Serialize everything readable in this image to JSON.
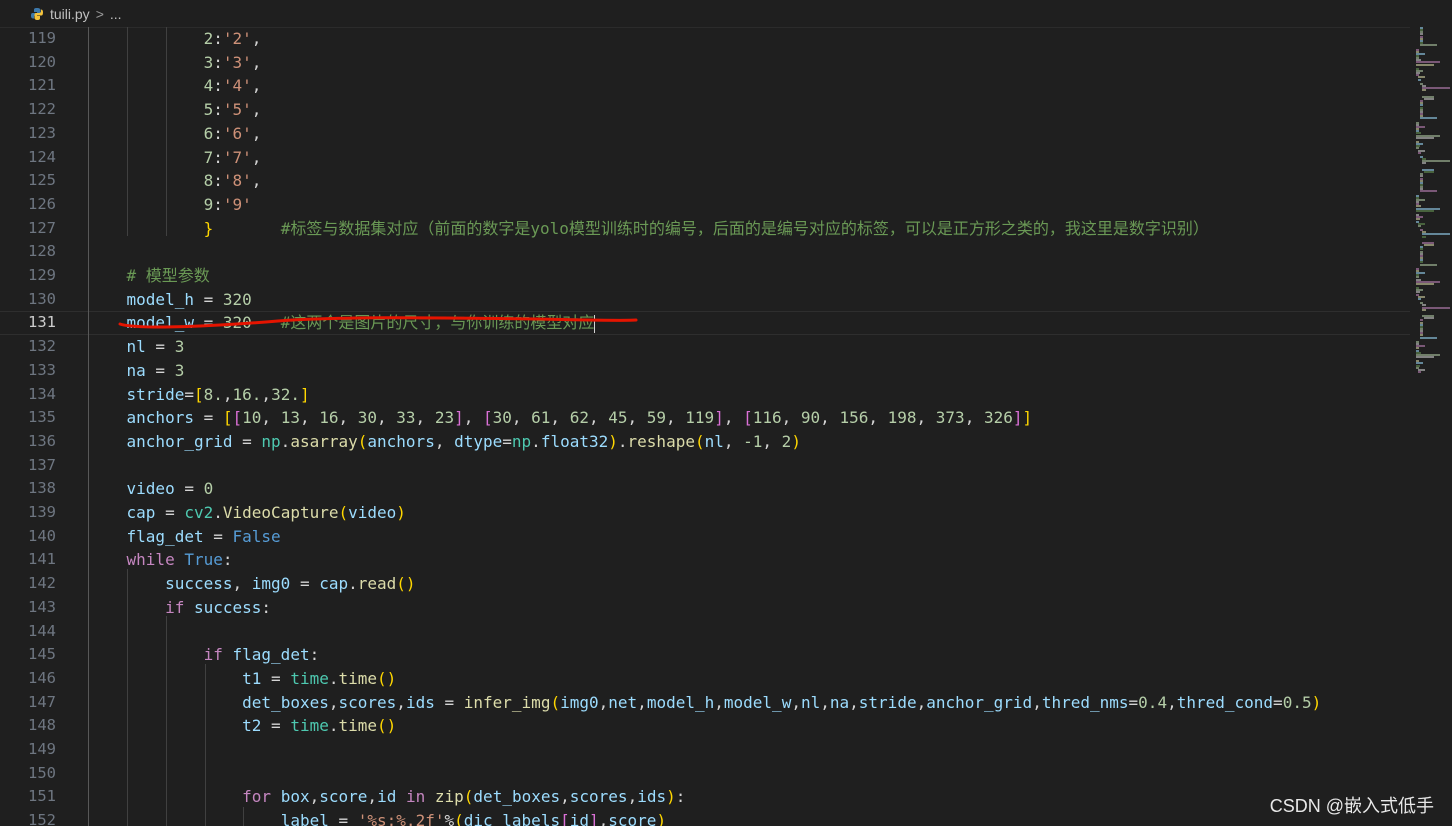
{
  "breadcrumb": {
    "file": "tuili.py",
    "separator": ">",
    "more": "..."
  },
  "watermark": "CSDN @嵌入式低手",
  "active_line": 131,
  "colors": {
    "plain": "#d4d4d4",
    "variable": "#9cdcfe",
    "number": "#b5cea8",
    "string": "#ce9178",
    "comment": "#6a9955",
    "keyword": "#c586c0",
    "constant": "#569cd6",
    "function": "#dcdcaa",
    "module": "#4ec9b0",
    "bracket_gold": "#ffd700",
    "bracket_pink": "#da70d6",
    "bracket_blue": "#179fff",
    "annotation": "#e51400"
  },
  "lines": [
    {
      "n": "119",
      "indent": 3,
      "tokens": [
        [
          "number",
          "2"
        ],
        [
          "plain",
          ":"
        ],
        [
          "string",
          "'2'"
        ],
        [
          "plain",
          ","
        ]
      ]
    },
    {
      "n": "120",
      "indent": 3,
      "tokens": [
        [
          "number",
          "3"
        ],
        [
          "plain",
          ":"
        ],
        [
          "string",
          "'3'"
        ],
        [
          "plain",
          ","
        ]
      ]
    },
    {
      "n": "121",
      "indent": 3,
      "tokens": [
        [
          "number",
          "4"
        ],
        [
          "plain",
          ":"
        ],
        [
          "string",
          "'4'"
        ],
        [
          "plain",
          ","
        ]
      ]
    },
    {
      "n": "122",
      "indent": 3,
      "tokens": [
        [
          "number",
          "5"
        ],
        [
          "plain",
          ":"
        ],
        [
          "string",
          "'5'"
        ],
        [
          "plain",
          ","
        ]
      ]
    },
    {
      "n": "123",
      "indent": 3,
      "tokens": [
        [
          "number",
          "6"
        ],
        [
          "plain",
          ":"
        ],
        [
          "string",
          "'6'"
        ],
        [
          "plain",
          ","
        ]
      ]
    },
    {
      "n": "124",
      "indent": 3,
      "tokens": [
        [
          "number",
          "7"
        ],
        [
          "plain",
          ":"
        ],
        [
          "string",
          "'7'"
        ],
        [
          "plain",
          ","
        ]
      ]
    },
    {
      "n": "125",
      "indent": 3,
      "tokens": [
        [
          "number",
          "8"
        ],
        [
          "plain",
          ":"
        ],
        [
          "string",
          "'8'"
        ],
        [
          "plain",
          ","
        ]
      ]
    },
    {
      "n": "126",
      "indent": 3,
      "tokens": [
        [
          "number",
          "9"
        ],
        [
          "plain",
          ":"
        ],
        [
          "string",
          "'9'"
        ]
      ]
    },
    {
      "n": "127",
      "indent": 3,
      "tokens": [
        [
          "bracket_gold",
          "}"
        ],
        [
          "plain",
          "       "
        ],
        [
          "comment",
          "#标签与数据集对应（前面的数字是yolo模型训练时的编号，后面的是编号对应的标签，可以是正方形之类的，我这里是数字识别）"
        ]
      ]
    },
    {
      "n": "128",
      "indent": 0,
      "tokens": []
    },
    {
      "n": "129",
      "indent": 1,
      "tokens": [
        [
          "comment",
          "# 模型参数"
        ]
      ]
    },
    {
      "n": "130",
      "indent": 1,
      "tokens": [
        [
          "variable",
          "model_h"
        ],
        [
          "plain",
          " = "
        ],
        [
          "number",
          "320"
        ]
      ]
    },
    {
      "n": "131",
      "indent": 1,
      "tokens": [
        [
          "variable",
          "model_w"
        ],
        [
          "plain",
          " = "
        ],
        [
          "number",
          "320"
        ],
        [
          "plain",
          "   "
        ],
        [
          "comment",
          "#这两个是图片的尺寸，与你训练的模型对应"
        ]
      ]
    },
    {
      "n": "132",
      "indent": 1,
      "tokens": [
        [
          "variable",
          "nl"
        ],
        [
          "plain",
          " = "
        ],
        [
          "number",
          "3"
        ]
      ]
    },
    {
      "n": "133",
      "indent": 1,
      "tokens": [
        [
          "variable",
          "na"
        ],
        [
          "plain",
          " = "
        ],
        [
          "number",
          "3"
        ]
      ]
    },
    {
      "n": "134",
      "indent": 1,
      "tokens": [
        [
          "variable",
          "stride"
        ],
        [
          "plain",
          "="
        ],
        [
          "bracket_gold",
          "["
        ],
        [
          "number",
          "8."
        ],
        [
          "plain",
          ","
        ],
        [
          "number",
          "16."
        ],
        [
          "plain",
          ","
        ],
        [
          "number",
          "32."
        ],
        [
          "bracket_gold",
          "]"
        ]
      ]
    },
    {
      "n": "135",
      "indent": 1,
      "tokens": [
        [
          "variable",
          "anchors"
        ],
        [
          "plain",
          " = "
        ],
        [
          "bracket_gold",
          "["
        ],
        [
          "bracket_pink",
          "["
        ],
        [
          "number",
          "10"
        ],
        [
          "plain",
          ", "
        ],
        [
          "number",
          "13"
        ],
        [
          "plain",
          ", "
        ],
        [
          "number",
          "16"
        ],
        [
          "plain",
          ", "
        ],
        [
          "number",
          "30"
        ],
        [
          "plain",
          ", "
        ],
        [
          "number",
          "33"
        ],
        [
          "plain",
          ", "
        ],
        [
          "number",
          "23"
        ],
        [
          "bracket_pink",
          "]"
        ],
        [
          "plain",
          ", "
        ],
        [
          "bracket_pink",
          "["
        ],
        [
          "number",
          "30"
        ],
        [
          "plain",
          ", "
        ],
        [
          "number",
          "61"
        ],
        [
          "plain",
          ", "
        ],
        [
          "number",
          "62"
        ],
        [
          "plain",
          ", "
        ],
        [
          "number",
          "45"
        ],
        [
          "plain",
          ", "
        ],
        [
          "number",
          "59"
        ],
        [
          "plain",
          ", "
        ],
        [
          "number",
          "119"
        ],
        [
          "bracket_pink",
          "]"
        ],
        [
          "plain",
          ", "
        ],
        [
          "bracket_pink",
          "["
        ],
        [
          "number",
          "116"
        ],
        [
          "plain",
          ", "
        ],
        [
          "number",
          "90"
        ],
        [
          "plain",
          ", "
        ],
        [
          "number",
          "156"
        ],
        [
          "plain",
          ", "
        ],
        [
          "number",
          "198"
        ],
        [
          "plain",
          ", "
        ],
        [
          "number",
          "373"
        ],
        [
          "plain",
          ", "
        ],
        [
          "number",
          "326"
        ],
        [
          "bracket_pink",
          "]"
        ],
        [
          "bracket_gold",
          "]"
        ]
      ]
    },
    {
      "n": "136",
      "indent": 1,
      "tokens": [
        [
          "variable",
          "anchor_grid"
        ],
        [
          "plain",
          " = "
        ],
        [
          "module",
          "np"
        ],
        [
          "plain",
          "."
        ],
        [
          "function",
          "asarray"
        ],
        [
          "bracket_gold",
          "("
        ],
        [
          "variable",
          "anchors"
        ],
        [
          "plain",
          ", "
        ],
        [
          "variable",
          "dtype"
        ],
        [
          "plain",
          "="
        ],
        [
          "module",
          "np"
        ],
        [
          "plain",
          "."
        ],
        [
          "variable",
          "float32"
        ],
        [
          "bracket_gold",
          ")"
        ],
        [
          "plain",
          "."
        ],
        [
          "function",
          "reshape"
        ],
        [
          "bracket_gold",
          "("
        ],
        [
          "variable",
          "nl"
        ],
        [
          "plain",
          ", "
        ],
        [
          "number",
          "-1"
        ],
        [
          "plain",
          ", "
        ],
        [
          "number",
          "2"
        ],
        [
          "bracket_gold",
          ")"
        ]
      ]
    },
    {
      "n": "137",
      "indent": 0,
      "tokens": []
    },
    {
      "n": "138",
      "indent": 1,
      "tokens": [
        [
          "variable",
          "video"
        ],
        [
          "plain",
          " = "
        ],
        [
          "number",
          "0"
        ]
      ]
    },
    {
      "n": "139",
      "indent": 1,
      "tokens": [
        [
          "variable",
          "cap"
        ],
        [
          "plain",
          " = "
        ],
        [
          "module",
          "cv2"
        ],
        [
          "plain",
          "."
        ],
        [
          "function",
          "VideoCapture"
        ],
        [
          "bracket_gold",
          "("
        ],
        [
          "variable",
          "video"
        ],
        [
          "bracket_gold",
          ")"
        ]
      ]
    },
    {
      "n": "140",
      "indent": 1,
      "tokens": [
        [
          "variable",
          "flag_det"
        ],
        [
          "plain",
          " = "
        ],
        [
          "constant",
          "False"
        ]
      ]
    },
    {
      "n": "141",
      "indent": 1,
      "tokens": [
        [
          "keyword",
          "while"
        ],
        [
          "plain",
          " "
        ],
        [
          "constant",
          "True"
        ],
        [
          "plain",
          ":"
        ]
      ]
    },
    {
      "n": "142",
      "indent": 2,
      "tokens": [
        [
          "variable",
          "success"
        ],
        [
          "plain",
          ", "
        ],
        [
          "variable",
          "img0"
        ],
        [
          "plain",
          " = "
        ],
        [
          "variable",
          "cap"
        ],
        [
          "plain",
          "."
        ],
        [
          "function",
          "read"
        ],
        [
          "bracket_gold",
          "()"
        ]
      ]
    },
    {
      "n": "143",
      "indent": 2,
      "tokens": [
        [
          "keyword",
          "if"
        ],
        [
          "plain",
          " "
        ],
        [
          "variable",
          "success"
        ],
        [
          "plain",
          ":"
        ]
      ]
    },
    {
      "n": "144",
      "indent": 0,
      "tokens": []
    },
    {
      "n": "145",
      "indent": 3,
      "tokens": [
        [
          "keyword",
          "if"
        ],
        [
          "plain",
          " "
        ],
        [
          "variable",
          "flag_det"
        ],
        [
          "plain",
          ":"
        ]
      ]
    },
    {
      "n": "146",
      "indent": 4,
      "tokens": [
        [
          "variable",
          "t1"
        ],
        [
          "plain",
          " = "
        ],
        [
          "module",
          "time"
        ],
        [
          "plain",
          "."
        ],
        [
          "function",
          "time"
        ],
        [
          "bracket_gold",
          "()"
        ]
      ]
    },
    {
      "n": "147",
      "indent": 4,
      "tokens": [
        [
          "variable",
          "det_boxes"
        ],
        [
          "plain",
          ","
        ],
        [
          "variable",
          "scores"
        ],
        [
          "plain",
          ","
        ],
        [
          "variable",
          "ids"
        ],
        [
          "plain",
          " = "
        ],
        [
          "function",
          "infer_img"
        ],
        [
          "bracket_gold",
          "("
        ],
        [
          "variable",
          "img0"
        ],
        [
          "plain",
          ","
        ],
        [
          "variable",
          "net"
        ],
        [
          "plain",
          ","
        ],
        [
          "variable",
          "model_h"
        ],
        [
          "plain",
          ","
        ],
        [
          "variable",
          "model_w"
        ],
        [
          "plain",
          ","
        ],
        [
          "variable",
          "nl"
        ],
        [
          "plain",
          ","
        ],
        [
          "variable",
          "na"
        ],
        [
          "plain",
          ","
        ],
        [
          "variable",
          "stride"
        ],
        [
          "plain",
          ","
        ],
        [
          "variable",
          "anchor_grid"
        ],
        [
          "plain",
          ","
        ],
        [
          "variable",
          "thred_nms"
        ],
        [
          "plain",
          "="
        ],
        [
          "number",
          "0.4"
        ],
        [
          "plain",
          ","
        ],
        [
          "variable",
          "thred_cond"
        ],
        [
          "plain",
          "="
        ],
        [
          "number",
          "0.5"
        ],
        [
          "bracket_gold",
          ")"
        ]
      ]
    },
    {
      "n": "148",
      "indent": 4,
      "tokens": [
        [
          "variable",
          "t2"
        ],
        [
          "plain",
          " = "
        ],
        [
          "module",
          "time"
        ],
        [
          "plain",
          "."
        ],
        [
          "function",
          "time"
        ],
        [
          "bracket_gold",
          "()"
        ]
      ]
    },
    {
      "n": "149",
      "indent": 0,
      "tokens": []
    },
    {
      "n": "150",
      "indent": 0,
      "tokens": []
    },
    {
      "n": "151",
      "indent": 4,
      "tokens": [
        [
          "keyword",
          "for"
        ],
        [
          "plain",
          " "
        ],
        [
          "variable",
          "box"
        ],
        [
          "plain",
          ","
        ],
        [
          "variable",
          "score"
        ],
        [
          "plain",
          ","
        ],
        [
          "variable",
          "id"
        ],
        [
          "plain",
          " "
        ],
        [
          "keyword",
          "in"
        ],
        [
          "plain",
          " "
        ],
        [
          "function",
          "zip"
        ],
        [
          "bracket_gold",
          "("
        ],
        [
          "variable",
          "det_boxes"
        ],
        [
          "plain",
          ","
        ],
        [
          "variable",
          "scores"
        ],
        [
          "plain",
          ","
        ],
        [
          "variable",
          "ids"
        ],
        [
          "bracket_gold",
          ")"
        ],
        [
          "plain",
          ":"
        ]
      ]
    },
    {
      "n": "152",
      "indent": 5,
      "tokens": [
        [
          "variable",
          "label"
        ],
        [
          "plain",
          " = "
        ],
        [
          "string",
          "'%s:%.2f'"
        ],
        [
          "plain",
          "%"
        ],
        [
          "bracket_gold",
          "("
        ],
        [
          "variable",
          "dic_labels"
        ],
        [
          "bracket_pink",
          "["
        ],
        [
          "variable",
          "id"
        ],
        [
          "bracket_pink",
          "]"
        ],
        [
          "plain",
          ","
        ],
        [
          "variable",
          "score"
        ],
        [
          "bracket_gold",
          ")"
        ]
      ]
    }
  ]
}
